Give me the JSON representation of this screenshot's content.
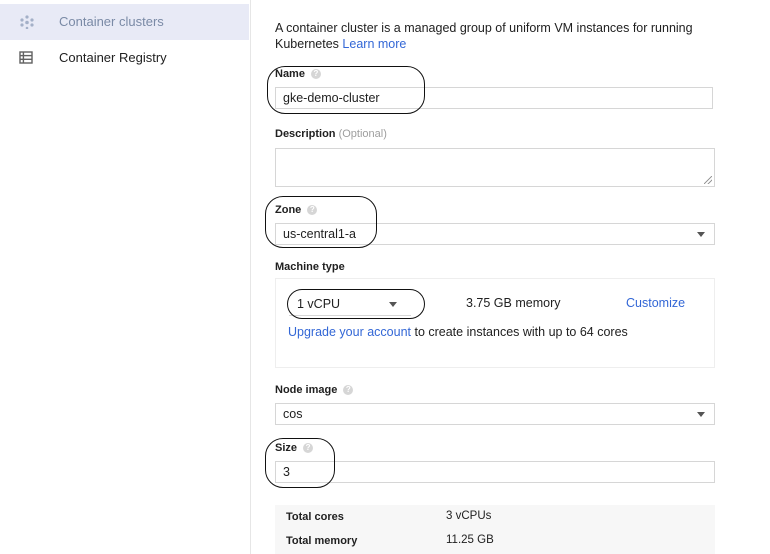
{
  "sidebar": {
    "items": [
      {
        "label": "Container clusters",
        "icon": "container-clusters-icon",
        "active": true
      },
      {
        "label": "Container Registry",
        "icon": "registry-list-icon",
        "active": false
      }
    ]
  },
  "form": {
    "intro_text": "A container cluster is a managed group of uniform VM instances for running Kubernetes",
    "learn_more": "Learn more",
    "name": {
      "label": "Name",
      "value": "gke-demo-cluster"
    },
    "description": {
      "label": "Description",
      "optional": "(Optional)",
      "value": ""
    },
    "zone": {
      "label": "Zone",
      "value": "us-central1-a"
    },
    "machine_type": {
      "label": "Machine type",
      "vcpu": "1 vCPU",
      "memory": "3.75 GB memory",
      "customize": "Customize",
      "upgrade_link": "Upgrade your account",
      "upgrade_rest": " to create instances with up to 64 cores"
    },
    "node_image": {
      "label": "Node image",
      "value": "cos"
    },
    "size": {
      "label": "Size",
      "value": "3"
    },
    "summary": {
      "total_cores_label": "Total cores",
      "total_cores_value": "3 vCPUs",
      "total_memory_label": "Total memory",
      "total_memory_value": "11.25 GB"
    }
  },
  "colors": {
    "link": "#3367d6",
    "active_nav_bg": "#e8eaf6"
  }
}
